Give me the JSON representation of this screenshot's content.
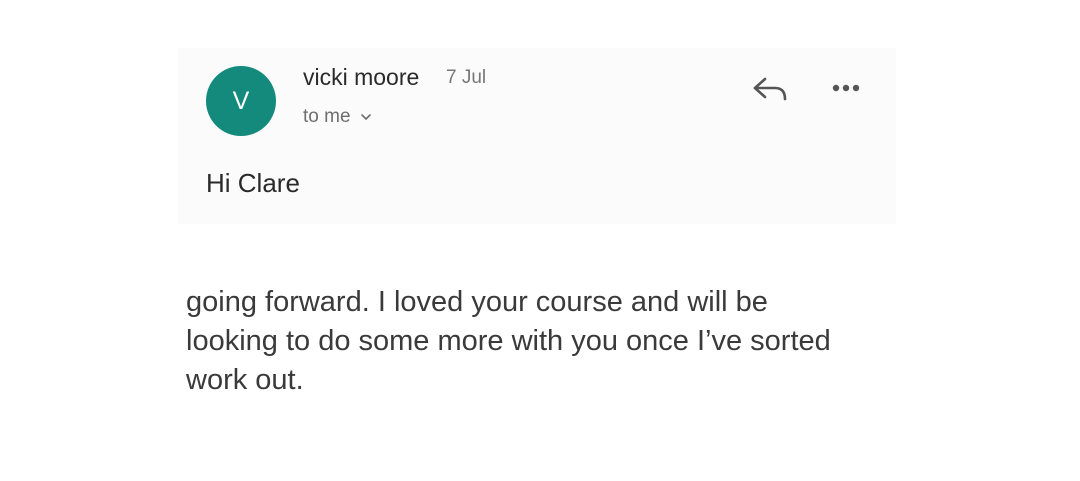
{
  "email": {
    "sender": {
      "avatar_letter": "V",
      "name": "vicki moore",
      "date": "7 Jul",
      "recipient": "to me"
    },
    "greeting": "Hi Clare",
    "body_lines": [
      "going forward. I loved your course and will be",
      "looking to do some more with you once I’ve sorted",
      "work out."
    ]
  },
  "icons": {
    "reply": "reply-icon",
    "more": "more-options-icon",
    "recipient_toggle": "chevron-down-icon"
  },
  "colors": {
    "avatar_bg": "#138a7c",
    "card_bg": "#fbfbfb",
    "text": "#2a2a2a",
    "muted_text": "#6e6e6e"
  }
}
